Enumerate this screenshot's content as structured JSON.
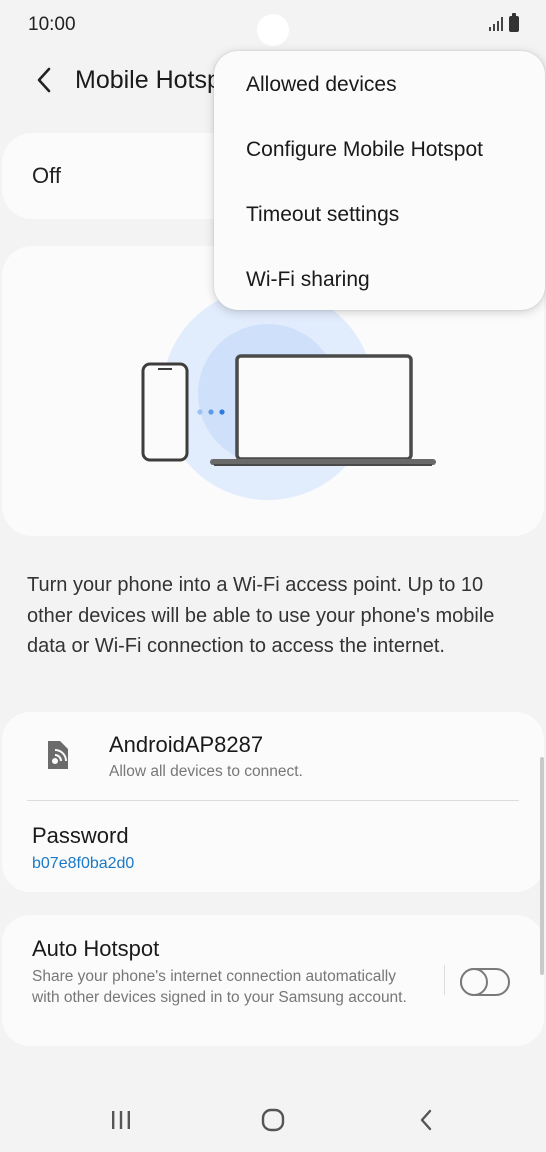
{
  "status_bar": {
    "time": "10:00"
  },
  "header": {
    "title": "Mobile Hotspot"
  },
  "hotspot_toggle": {
    "state_label": "Off"
  },
  "description": "Turn your phone into a Wi-Fi access point. Up to 10 other devices will be able to use your phone's mobile data or Wi-Fi connection to access the internet.",
  "network": {
    "name": "AndroidAP8287",
    "subtitle": "Allow all devices to connect.",
    "password_label": "Password",
    "password_value": "b07e8f0ba2d0"
  },
  "auto_hotspot": {
    "title": "Auto Hotspot",
    "description": "Share your phone's internet connection automatically with other devices signed in to your Samsung account.",
    "enabled": false
  },
  "popup_menu": {
    "items": [
      "Allowed devices",
      "Configure Mobile Hotspot",
      "Timeout settings",
      "Wi-Fi sharing"
    ]
  },
  "colors": {
    "accent": "#1b79c8",
    "illustration_blue": "#d9e7fb"
  },
  "icons": {
    "back": "chevron-left-icon",
    "network": "hotspot-icon",
    "nav_recents": "recents-icon",
    "nav_home": "home-icon",
    "nav_back": "back-icon"
  }
}
